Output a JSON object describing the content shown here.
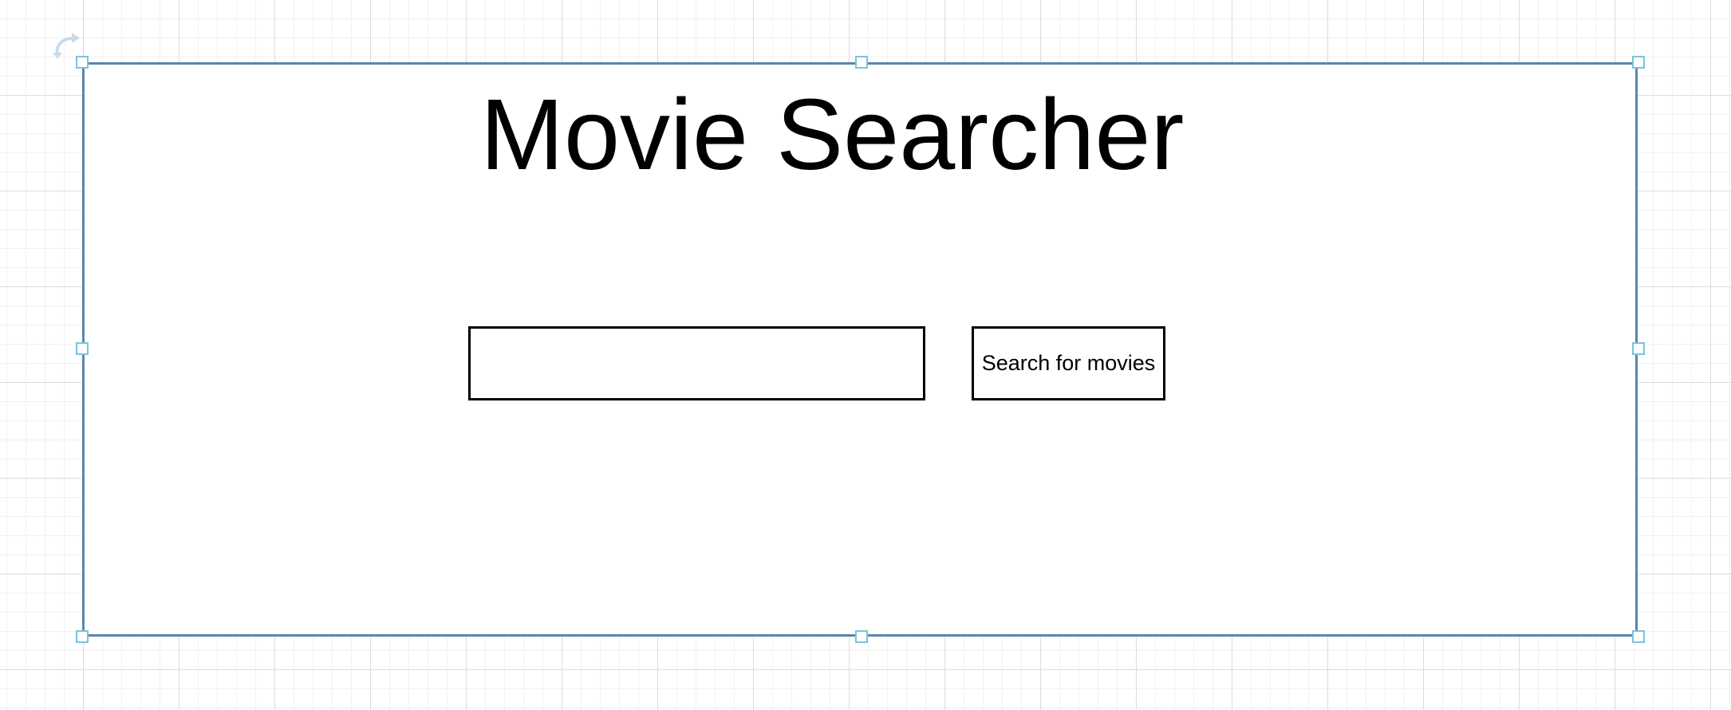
{
  "header": {
    "title": "Movie Searcher"
  },
  "search": {
    "value": "",
    "placeholder": "",
    "button_label": "Search for movies"
  },
  "selection": {
    "handle_names": [
      "top-left",
      "top-center",
      "top-right",
      "middle-left",
      "middle-right",
      "bottom-left",
      "bottom-center",
      "bottom-right"
    ],
    "rotate_icon": "rotate-icon",
    "border_color": "#5a86ac",
    "handle_color": "#7cc3dd"
  }
}
